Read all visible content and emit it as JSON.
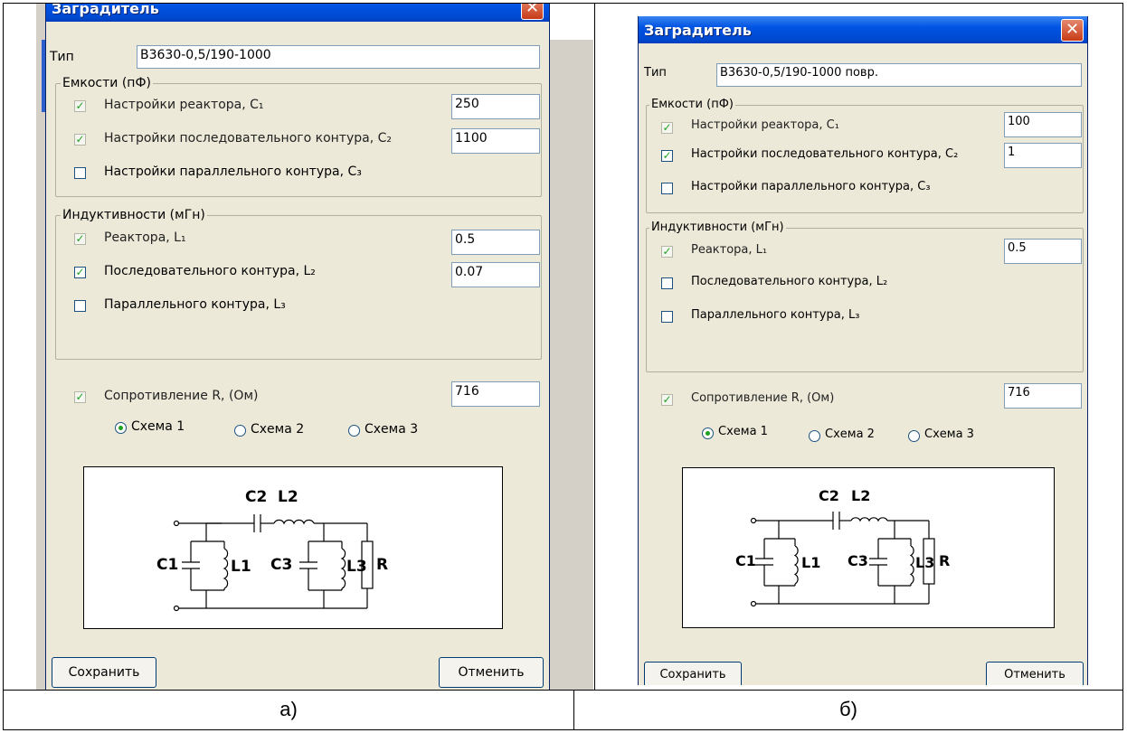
{
  "captions": {
    "left": "а)",
    "right": "б)"
  },
  "dialogs": [
    {
      "title": "Заградитель",
      "type_label": "Тип",
      "type_value": "В3630-0,5/190-1000",
      "cap_group": "Емкости (пФ)",
      "cap_items": [
        {
          "label": "Настройки реактора, C₁",
          "value": "250",
          "state": "checked-disabled"
        },
        {
          "label": "Настройки последовательного контура, C₂",
          "value": "1100",
          "state": "checked-disabled"
        },
        {
          "label": "Настройки параллельного контура, C₃",
          "value": "",
          "state": "unchecked"
        }
      ],
      "ind_group": "Индуктивности (мГн)",
      "ind_items": [
        {
          "label": "Реактора, L₁",
          "value": "0.5",
          "state": "checked-disabled"
        },
        {
          "label": "Последовательного контура, L₂",
          "value": "0.07",
          "state": "checked"
        },
        {
          "label": "Параллельного контура, L₃",
          "value": "",
          "state": "unchecked"
        }
      ],
      "res_label": "Сопротивление R, (Ом)",
      "res_value": "716",
      "schemes": [
        "Схема 1",
        "Схема 2",
        "Схема 3"
      ],
      "selected_scheme": "Схема 1",
      "save_label": "Сохранить",
      "cancel_label": "Отменить",
      "circuit_labels": {
        "c1": "C1",
        "l1": "L1",
        "c2": "C2",
        "l2": "L2",
        "c3": "C3",
        "l3": "L3",
        "r": "R"
      }
    },
    {
      "title": "Заградитель",
      "type_label": "Тип",
      "type_value": "В3630-0,5/190-1000 повр.",
      "cap_group": "Емкости (пФ)",
      "cap_items": [
        {
          "label": "Настройки реактора, C₁",
          "value": "100",
          "state": "checked-disabled"
        },
        {
          "label": "Настройки последовательного контура, C₂",
          "value": "1",
          "state": "checked"
        },
        {
          "label": "Настройки параллельного контура, C₃",
          "value": "",
          "state": "unchecked"
        }
      ],
      "ind_group": "Индуктивности (мГн)",
      "ind_items": [
        {
          "label": "Реактора, L₁",
          "value": "0.5",
          "state": "checked-disabled"
        },
        {
          "label": "Последовательного контура, L₂",
          "value": "",
          "state": "unchecked"
        },
        {
          "label": "Параллельного контура, L₃",
          "value": "",
          "state": "unchecked"
        }
      ],
      "res_label": "Сопротивление R, (Ом)",
      "res_value": "716",
      "schemes": [
        "Схема 1",
        "Схема 2",
        "Схема 3"
      ],
      "selected_scheme": "Схема 1",
      "save_label": "Сохранить",
      "cancel_label": "Отменить",
      "circuit_labels": {
        "c1": "C1",
        "l1": "L1",
        "c2": "C2",
        "l2": "L2",
        "c3": "C3",
        "l3": "L3",
        "r": "R"
      }
    }
  ]
}
